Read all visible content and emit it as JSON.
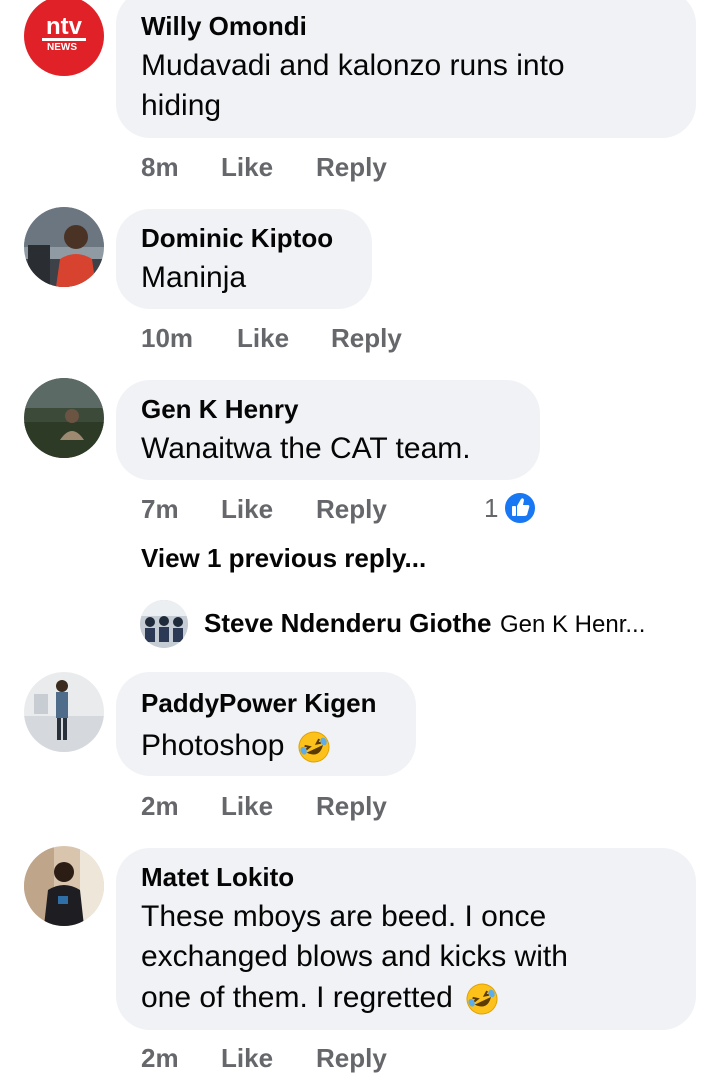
{
  "comments": [
    {
      "name": "Willy Omondi",
      "text_lines": [
        "Mudavadi and kalonzo runs into",
        "hiding"
      ],
      "time": "8m",
      "like": "Like",
      "reply": "Reply",
      "avatar": "ntv-news-logo"
    },
    {
      "name": "Dominic Kiptoo",
      "text": "Maninja",
      "time": "10m",
      "like": "Like",
      "reply": "Reply",
      "avatar": "person-photo"
    },
    {
      "name": "Gen K Henry",
      "text": "Wanaitwa the CAT team.",
      "time": "7m",
      "like": "Like",
      "reply": "Reply",
      "reactions_count": "1",
      "reaction_icon": "thumbs-up-icon",
      "view_replies": "View 1 previous reply...",
      "reply_preview": {
        "name": "Steve Ndenderu Giothe",
        "text": "Gen K Henr..."
      }
    },
    {
      "name": "PaddyPower Kigen",
      "text": "Photoshop",
      "emoji": "rofl-emoji-icon",
      "time": "2m",
      "like": "Like",
      "reply": "Reply",
      "avatar": "person-photo"
    },
    {
      "name": "Matet Lokito",
      "text_lines": [
        "These mboys are beed. I once",
        "exchanged blows and kicks with",
        "one of them. I regretted"
      ],
      "emoji": "rofl-emoji-icon",
      "time": "2m",
      "like": "Like",
      "reply": "Reply",
      "avatar": "person-photo"
    }
  ],
  "avatar_logo_text": {
    "brand": "ntv",
    "sub": "NEWS"
  },
  "colors": {
    "bubble": "#f0f2f5",
    "meta": "#65676b",
    "like_blue": "#1877f2",
    "ntv_red": "#e02127"
  }
}
